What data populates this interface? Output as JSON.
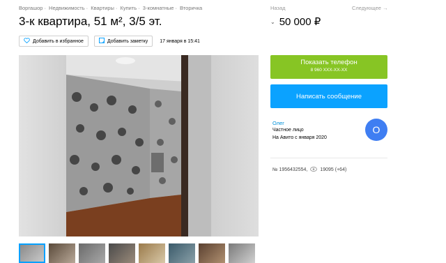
{
  "breadcrumbs": [
    "Воргашор",
    "Недвижимость",
    "Квартиры",
    "Купить",
    "3-комнатные",
    "Вторичка"
  ],
  "title": "3-к квартира, 51 м², 3/5 эт.",
  "actions": {
    "favorite_label": "Добавить в избранное",
    "note_label": "Добавить заметку",
    "date": "17 января в 15:41"
  },
  "nav": {
    "back": "Назад",
    "next": "Следующее →"
  },
  "price": "50 000 ₽",
  "phone_button": {
    "label": "Показать телефон",
    "number": "8 960 XXX-XX-XX"
  },
  "message_button": {
    "label": "Написать сообщение"
  },
  "seller": {
    "name": "Олег",
    "type": "Частное лицо",
    "since": "На Авито с января 2020",
    "avatar_letter": "О"
  },
  "listing": {
    "number": "№ 1956432554,",
    "views": "19095 (+64)"
  },
  "thumbnails": 8,
  "colors": {
    "green": "#87c524",
    "blue": "#0ba2ff",
    "link": "#0091d9",
    "avatar": "#3f7ef2"
  },
  "icons": [
    "heart-icon",
    "note-icon",
    "chevron-down-icon",
    "eye-icon"
  ]
}
